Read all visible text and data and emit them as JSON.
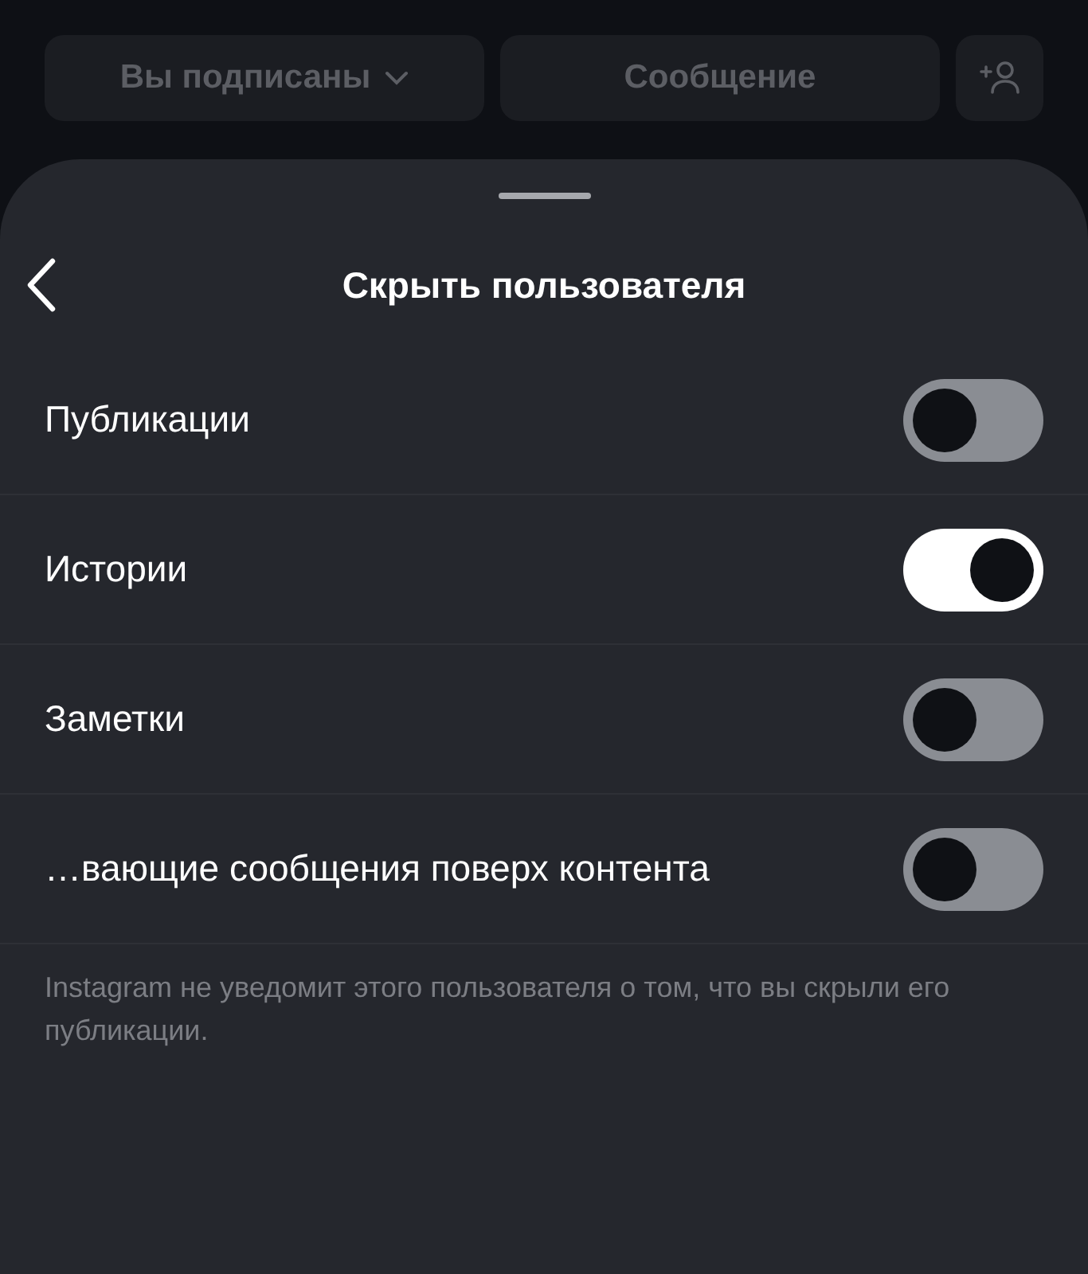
{
  "top_bar": {
    "follow_button": "Вы подписаны",
    "message_button": "Сообщение"
  },
  "sheet": {
    "title": "Скрыть пользователя",
    "options": [
      {
        "label": "Публикации",
        "on": false
      },
      {
        "label": "Истории",
        "on": true
      },
      {
        "label": "Заметки",
        "on": false
      },
      {
        "label": "…вающие сообщения поверх контента",
        "on": false
      }
    ],
    "note": "Instagram не уведомит этого пользователя о том, что вы скрыли его публикации."
  }
}
